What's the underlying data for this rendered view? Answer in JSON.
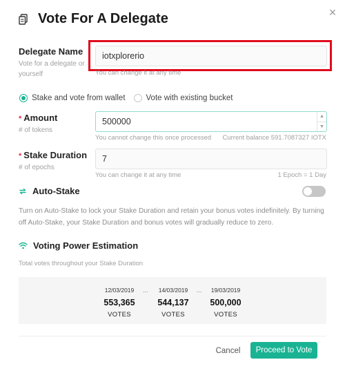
{
  "dialog": {
    "title": "Vote For A Delegate",
    "close_glyph": "×"
  },
  "delegate": {
    "label": "Delegate Name",
    "sublabel": "Vote for a delegate or yourself",
    "value": "iotxplorerio",
    "hint": "You can change it at any time"
  },
  "stake_mode": {
    "options": [
      {
        "label": "Stake and vote from wallet",
        "selected": true
      },
      {
        "label": "Vote with existing bucket",
        "selected": false
      }
    ]
  },
  "amount": {
    "required_mark": "*",
    "label": "Amount",
    "sublabel": "# of tokens",
    "value": "500000",
    "hint": "You cannot change this once processed",
    "balance": "Current balance 591.7087327 IOTX",
    "up_glyph": "▲",
    "down_glyph": "▼"
  },
  "duration": {
    "required_mark": "*",
    "label": "Stake Duration",
    "sublabel": "# of epochs",
    "value": "7",
    "hint": "You can change it at any time",
    "epoch_note": "1 Epoch = 1 Day"
  },
  "auto_stake": {
    "label": "Auto-Stake",
    "enabled": false,
    "description": "Turn on Auto-Stake to lock your Stake Duration and retain your bonus votes indefinitely. By turning off Auto-Stake, your Stake Duration and bonus votes will gradually reduce to zero."
  },
  "voting_power": {
    "title": "Voting Power Estimation",
    "subtitle": "Total votes throughout your Stake Duration",
    "ellipsis": "...",
    "points": [
      {
        "date": "12/03/2019",
        "value": "553,365",
        "unit": "VOTES"
      },
      {
        "date": "14/03/2019",
        "value": "544,137",
        "unit": "VOTES"
      },
      {
        "date": "19/03/2019",
        "value": "500,000",
        "unit": "VOTES"
      }
    ]
  },
  "footer": {
    "cancel_label": "Cancel",
    "proceed_label": "Proceed to Vote"
  },
  "colors": {
    "accent": "#19b393",
    "highlight_border": "#e0091c",
    "required": "#e0314b"
  }
}
